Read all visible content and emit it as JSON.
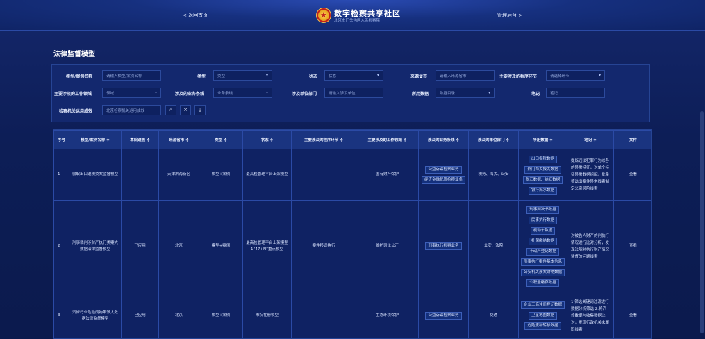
{
  "header": {
    "back_label": "< 返回首页",
    "admin_label": "管理后台 >",
    "title": "数字检察共享社区",
    "subtitle": "北京市门头沟区人民检察院"
  },
  "page_title": "法律监督模型",
  "filters": {
    "model_name": {
      "label": "模型/案例名称",
      "placeholder": "请输入模型/案例名称"
    },
    "type": {
      "label": "类型",
      "value": "类型"
    },
    "status": {
      "label": "状态",
      "value": "状态"
    },
    "source_city": {
      "label": "来源省市",
      "placeholder": "请输入来源省市"
    },
    "procedure": {
      "label": "主要涉及的程序环节",
      "value": "请选择环节"
    },
    "work_field": {
      "label": "主要涉及的工作领域",
      "value": "领域"
    },
    "business_line": {
      "label": "涉及的业务条线",
      "value": "业务条线"
    },
    "unit": {
      "label": "涉及单位部门",
      "placeholder": "请输入涉及单位"
    },
    "data_used": {
      "label": "所用数据",
      "value": "数据目录"
    },
    "notes": {
      "label": "笔记",
      "placeholder": "笔记"
    },
    "organ": {
      "label": "检察机关运用成效",
      "value": "北京检察机关运用成效"
    }
  },
  "table": {
    "headers": [
      "序号",
      "模型/案例名称 ≑",
      "本院进展 ≑",
      "来源省市 ≑",
      "类型 ≑",
      "状态 ≑",
      "主要涉及的程序环节 ≑",
      "主要涉及的工作领域 ≑",
      "涉及的业务条线 ≑",
      "涉及的单位部门 ≑",
      "所用数据 ≑",
      "笔记 ≑",
      "文件"
    ],
    "rows": [
      {
        "index": "1",
        "name": "骗取出口退税类案监督模型",
        "progress": "",
        "source": "天津滨海新区",
        "type": "模型+案例",
        "status": "最高检管理平台上架模型",
        "procedure": "",
        "field": "国有财产保护",
        "business": [
          "公益诉讼检察业务",
          "经济金融犯罪检察业务"
        ],
        "units": "税务、海关、公安",
        "data": [
          "出口报税数据",
          "外门海关报关数据",
          "税汇数据、结汇数据",
          "银行流水数据"
        ],
        "note": "提炼违法犯罪行为以各的异常特征，对单个特征异常数据组配，批量筛选出案件异常线索制定义实风险线索",
        "file": "查看"
      },
      {
        "index": "2",
        "name": "刑事裁判涉财产执行类案大数据法律监督模型",
        "progress": "已应用",
        "source": "北京",
        "type": "模型+案例",
        "status": "最高检管理平台上架模型1“47+N”重点模型",
        "procedure": "案件移送执行",
        "field": "维护司法公正",
        "business": [
          "刑事执行检察业务"
        ],
        "units": "公安、法院",
        "data": [
          "刑事判决书数据",
          "民事执行数据",
          "机动车数据",
          "社保缴纳数据",
          "不动产登记数据",
          "刑事执行案件基本信息",
          "公安机关涉案财物数据",
          "公积金缴存数据"
        ],
        "note": "对被告人财产的判执行情况进行比对分析，发现法院对执行财产情况监督的问题线索",
        "file": "查看"
      },
      {
        "index": "3",
        "name": "汽修行业危险废物带涉大数据法律监督模型",
        "progress": "已应用",
        "source": "北京",
        "type": "模型+案例",
        "status": "市院在册模型",
        "procedure": "",
        "field": "生态环境保护",
        "business": [
          "公益诉讼检察业务"
        ],
        "units": "交通",
        "data": [
          "企业工商注册登记数据",
          "卫星地图数据",
          "危险废物转移数据"
        ],
        "note": "1.筛选关键词过滤进行数据分析筛选 2.将汽修数据与收集数据比对，发现行政机关未履职线索",
        "file": "查看"
      }
    ]
  }
}
